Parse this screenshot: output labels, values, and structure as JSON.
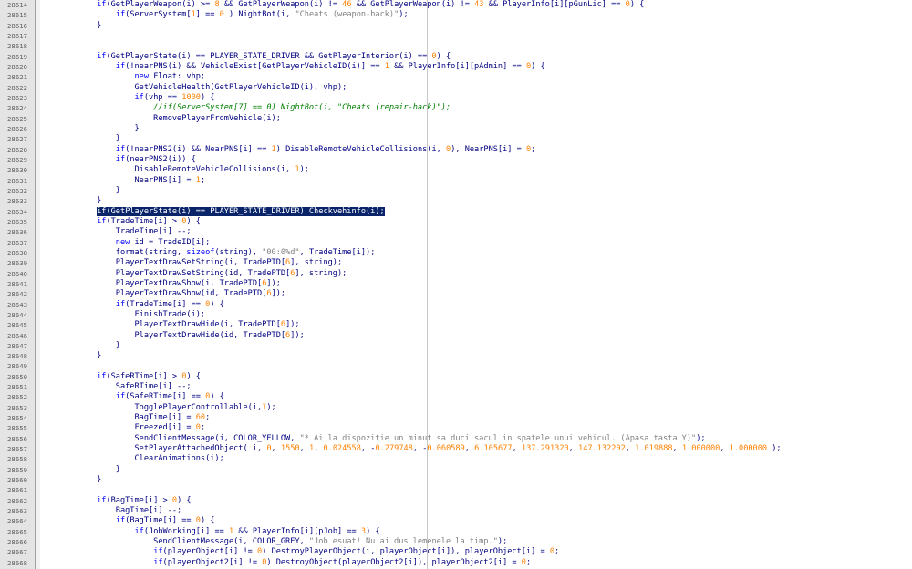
{
  "editor": {
    "selected_line": "28634",
    "lines": [
      {
        "n": "28614",
        "code": "            if(GetPlayerWeapon(i) >= 8 && GetPlayerWeapon(i) != 46 && GetPlayerWeapon(i) != 43 && PlayerInfo[i][pGunLic] == 0) {"
      },
      {
        "n": "28615",
        "code": "                if(ServerSystem[1] == 0 ) NightBot(i, \"Cheats (weapon-hack)\");"
      },
      {
        "n": "28616",
        "code": "            }"
      },
      {
        "n": "28617",
        "code": ""
      },
      {
        "n": "28618",
        "code": ""
      },
      {
        "n": "28619",
        "code": "            if(GetPlayerState(i) == PLAYER_STATE_DRIVER && GetPlayerInterior(i) == 0) {"
      },
      {
        "n": "28620",
        "code": "                if(!nearPNS(i) && VehicleExist[GetPlayerVehicleID(i)] == 1 && PlayerInfo[i][pAdmin] == 0) {"
      },
      {
        "n": "28621",
        "code": "                    new Float: vhp;"
      },
      {
        "n": "28622",
        "code": "                    GetVehicleHealth(GetPlayerVehicleID(i), vhp);"
      },
      {
        "n": "28623",
        "code": "                    if(vhp == 1000) {"
      },
      {
        "n": "28624",
        "code": "                        //if(ServerSystem[7] == 0) NightBot(i, \"Cheats (repair-hack)\");"
      },
      {
        "n": "28625",
        "code": "                        RemovePlayerFromVehicle(i);"
      },
      {
        "n": "28626",
        "code": "                    }"
      },
      {
        "n": "28627",
        "code": "                }"
      },
      {
        "n": "28628",
        "code": "                if(!nearPNS2(i) && NearPNS[i] == 1) DisableRemoteVehicleCollisions(i, 0), NearPNS[i] = 0;"
      },
      {
        "n": "28629",
        "code": "                if(nearPNS2(i)) {"
      },
      {
        "n": "28630",
        "code": "                    DisableRemoteVehicleCollisions(i, 1);"
      },
      {
        "n": "28631",
        "code": "                    NearPNS[i] = 1;"
      },
      {
        "n": "28632",
        "code": "                }"
      },
      {
        "n": "28633",
        "code": "            }"
      },
      {
        "n": "28634",
        "code": "            if(GetPlayerState(i) == PLAYER_STATE_DRIVER) Checkvehinfo(i);"
      },
      {
        "n": "28635",
        "code": "            if(TradeTime[i] > 0) {"
      },
      {
        "n": "28636",
        "code": "                TradeTime[i] --;"
      },
      {
        "n": "28637",
        "code": "                new id = TradeID[i];"
      },
      {
        "n": "28638",
        "code": "                format(string, sizeof(string), \"00:0%d\", TradeTime[i]);"
      },
      {
        "n": "28639",
        "code": "                PlayerTextDrawSetString(i, TradePTD[6], string);"
      },
      {
        "n": "28640",
        "code": "                PlayerTextDrawSetString(id, TradePTD[6], string);"
      },
      {
        "n": "28641",
        "code": "                PlayerTextDrawShow(i, TradePTD[6]);"
      },
      {
        "n": "28642",
        "code": "                PlayerTextDrawShow(id, TradePTD[6]);"
      },
      {
        "n": "28643",
        "code": "                if(TradeTime[i] == 0) {"
      },
      {
        "n": "28644",
        "code": "                    FinishTrade(i);"
      },
      {
        "n": "28645",
        "code": "                    PlayerTextDrawHide(i, TradePTD[6]);"
      },
      {
        "n": "28646",
        "code": "                    PlayerTextDrawHide(id, TradePTD[6]);"
      },
      {
        "n": "28647",
        "code": "                }"
      },
      {
        "n": "28648",
        "code": "            }"
      },
      {
        "n": "28649",
        "code": ""
      },
      {
        "n": "28650",
        "code": "            if(SafeRTime[i] > 0) {"
      },
      {
        "n": "28651",
        "code": "                SafeRTime[i] --;"
      },
      {
        "n": "28652",
        "code": "                if(SafeRTime[i] == 0) {"
      },
      {
        "n": "28653",
        "code": "                    TogglePlayerControllable(i,1);"
      },
      {
        "n": "28654",
        "code": "                    BagTime[i] = 60;"
      },
      {
        "n": "28655",
        "code": "                    Freezed[i] = 0;"
      },
      {
        "n": "28656",
        "code": "                    SendClientMessage(i, COLOR_YELLOW, \"* Ai la dispozitie un minut sa duci sacul in spatele unui vehicul. (Apasa tasta Y)\");"
      },
      {
        "n": "28657",
        "code": "                    SetPlayerAttachedObject( i, 0, 1550, 1, 0.024558, -0.279748, -0.060589, 6.105677, 137.291320, 147.132202, 1.019888, 1.000000, 1.000000 );"
      },
      {
        "n": "28658",
        "code": "                    ClearAnimations(i);"
      },
      {
        "n": "28659",
        "code": "                }"
      },
      {
        "n": "28660",
        "code": "            }"
      },
      {
        "n": "28661",
        "code": ""
      },
      {
        "n": "28662",
        "code": "            if(BagTime[i] > 0) {"
      },
      {
        "n": "28663",
        "code": "                BagTime[i] --;"
      },
      {
        "n": "28664",
        "code": "                if(BagTime[i] == 0) {"
      },
      {
        "n": "28665",
        "code": "                    if(JobWorking[i] == 1 && PlayerInfo[i][pJob] == 3) {"
      },
      {
        "n": "28666",
        "code": "                        SendClientMessage(i, COLOR_GREY, \"Job esuat! Nu ai dus lemenele la timp.\");"
      },
      {
        "n": "28667",
        "code": "                        if(playerObject[i] != 0) DestroyPlayerObject(i, playerObject[i]), playerObject[i] = 0;"
      },
      {
        "n": "28668",
        "code": "                        if(playerObject2[i] != 0) DestroyObject(playerObject2[i]), playerObject2[i] = 0;"
      }
    ]
  },
  "colors": {
    "default": "#000080",
    "keyword": "#0000ff",
    "string": "#808080",
    "comment": "#008000",
    "number": "#ff8000",
    "selection": "#0a246a",
    "gutter": "#e4e4e4"
  }
}
